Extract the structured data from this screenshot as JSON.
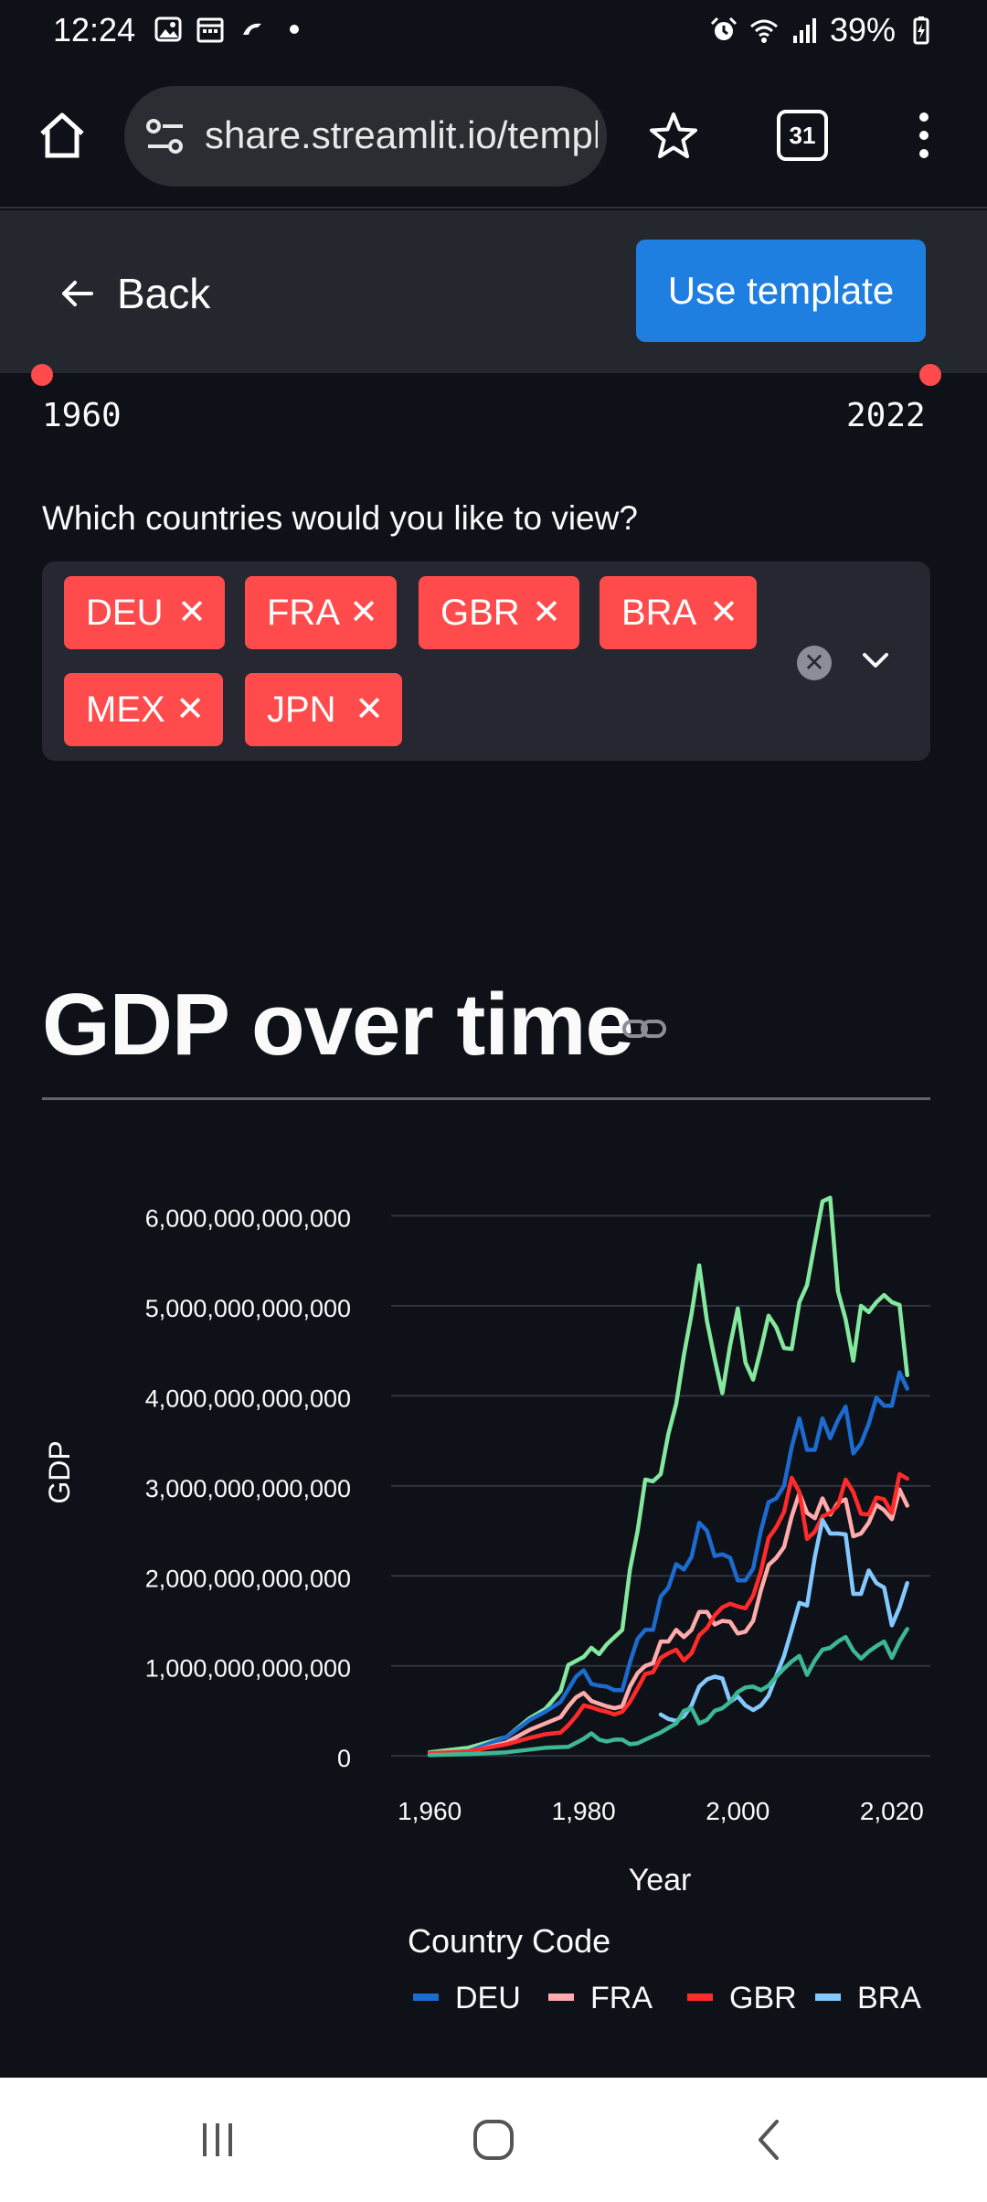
{
  "status": {
    "time": "12:24",
    "battery": "39%"
  },
  "browser": {
    "url": "share.streamlit.io/template-preview",
    "tab_count": "31"
  },
  "header": {
    "back_label": "Back",
    "use_template_label": "Use template"
  },
  "slider": {
    "min_label": "1960",
    "max_label": "2022"
  },
  "countries": {
    "question": "Which countries would you like to view?",
    "selected": [
      "DEU",
      "FRA",
      "GBR",
      "BRA",
      "MEX",
      "JPN"
    ]
  },
  "section": {
    "title": "GDP over time"
  },
  "chart_data": {
    "type": "line",
    "xlabel": "Year",
    "ylabel": "GDP",
    "xlim": [
      1955,
      2025
    ],
    "ylim": [
      -100000000000,
      6300000000000
    ],
    "x_ticks": [
      1960,
      1980,
      2000,
      2020
    ],
    "x_tick_labels": [
      "1,960",
      "1,980",
      "2,000",
      "2,020"
    ],
    "y_ticks": [
      0,
      1000000000000,
      2000000000000,
      3000000000000,
      4000000000000,
      5000000000000,
      6000000000000
    ],
    "y_tick_labels": [
      "0",
      "1,000,000,000,000",
      "2,000,000,000,000",
      "3,000,000,000,000",
      "4,000,000,000,000",
      "5,000,000,000,000",
      "6,000,000,000,000"
    ],
    "legend_title": "Country Code",
    "legend_placement": "bottom",
    "grid": true,
    "series": [
      {
        "name": "JPN",
        "legend": false,
        "color": "#84e89f",
        "points": [
          [
            1960,
            0.04
          ],
          [
            1965,
            0.09
          ],
          [
            1970,
            0.21
          ],
          [
            1973,
            0.42
          ],
          [
            1975,
            0.52
          ],
          [
            1977,
            0.72
          ],
          [
            1978,
            1.01
          ],
          [
            1980,
            1.1
          ],
          [
            1981,
            1.2
          ],
          [
            1982,
            1.13
          ],
          [
            1983,
            1.24
          ],
          [
            1985,
            1.4
          ],
          [
            1986,
            2.07
          ],
          [
            1987,
            2.5
          ],
          [
            1988,
            3.07
          ],
          [
            1989,
            3.05
          ],
          [
            1990,
            3.13
          ],
          [
            1991,
            3.58
          ],
          [
            1992,
            3.91
          ],
          [
            1993,
            4.45
          ],
          [
            1994,
            4.91
          ],
          [
            1995,
            5.45
          ],
          [
            1996,
            4.83
          ],
          [
            1997,
            4.41
          ],
          [
            1998,
            4.03
          ],
          [
            1999,
            4.56
          ],
          [
            2000,
            4.97
          ],
          [
            2001,
            4.37
          ],
          [
            2002,
            4.18
          ],
          [
            2003,
            4.52
          ],
          [
            2004,
            4.89
          ],
          [
            2005,
            4.76
          ],
          [
            2006,
            4.53
          ],
          [
            2007,
            4.52
          ],
          [
            2008,
            5.04
          ],
          [
            2009,
            5.23
          ],
          [
            2010,
            5.7
          ],
          [
            2011,
            6.16
          ],
          [
            2012,
            6.2
          ],
          [
            2013,
            5.16
          ],
          [
            2014,
            4.85
          ],
          [
            2015,
            4.39
          ],
          [
            2016,
            5.0
          ],
          [
            2017,
            4.93
          ],
          [
            2018,
            5.04
          ],
          [
            2019,
            5.12
          ],
          [
            2020,
            5.04
          ],
          [
            2021,
            5.01
          ],
          [
            2022,
            4.23
          ]
        ]
      },
      {
        "name": "DEU",
        "legend": true,
        "color": "#1c6bd0",
        "points": [
          [
            1960,
            0.02
          ],
          [
            1965,
            0.05
          ],
          [
            1970,
            0.21
          ],
          [
            1973,
            0.4
          ],
          [
            1975,
            0.49
          ],
          [
            1977,
            0.6
          ],
          [
            1978,
            0.74
          ],
          [
            1979,
            0.88
          ],
          [
            1980,
            0.95
          ],
          [
            1981,
            0.8
          ],
          [
            1982,
            0.78
          ],
          [
            1983,
            0.77
          ],
          [
            1984,
            0.73
          ],
          [
            1985,
            0.73
          ],
          [
            1986,
            1.04
          ],
          [
            1987,
            1.3
          ],
          [
            1988,
            1.4
          ],
          [
            1989,
            1.4
          ],
          [
            1990,
            1.77
          ],
          [
            1991,
            1.87
          ],
          [
            1992,
            2.13
          ],
          [
            1993,
            2.07
          ],
          [
            1994,
            2.21
          ],
          [
            1995,
            2.59
          ],
          [
            1996,
            2.5
          ],
          [
            1997,
            2.22
          ],
          [
            1998,
            2.24
          ],
          [
            1999,
            2.2
          ],
          [
            2000,
            1.95
          ],
          [
            2001,
            1.95
          ],
          [
            2002,
            2.08
          ],
          [
            2003,
            2.5
          ],
          [
            2004,
            2.82
          ],
          [
            2005,
            2.86
          ],
          [
            2006,
            3.0
          ],
          [
            2007,
            3.43
          ],
          [
            2008,
            3.75
          ],
          [
            2009,
            3.4
          ],
          [
            2010,
            3.4
          ],
          [
            2011,
            3.75
          ],
          [
            2012,
            3.53
          ],
          [
            2013,
            3.73
          ],
          [
            2014,
            3.88
          ],
          [
            2015,
            3.36
          ],
          [
            2016,
            3.47
          ],
          [
            2017,
            3.69
          ],
          [
            2018,
            3.98
          ],
          [
            2019,
            3.89
          ],
          [
            2020,
            3.89
          ],
          [
            2021,
            4.26
          ],
          [
            2022,
            4.08
          ]
        ]
      },
      {
        "name": "FRA",
        "legend": true,
        "color": "#ffabab",
        "points": [
          [
            1960,
            0.01
          ],
          [
            1965,
            0.04
          ],
          [
            1970,
            0.15
          ],
          [
            1973,
            0.29
          ],
          [
            1975,
            0.36
          ],
          [
            1977,
            0.43
          ],
          [
            1978,
            0.55
          ],
          [
            1979,
            0.65
          ],
          [
            1980,
            0.7
          ],
          [
            1981,
            0.61
          ],
          [
            1982,
            0.58
          ],
          [
            1983,
            0.55
          ],
          [
            1984,
            0.53
          ],
          [
            1985,
            0.55
          ],
          [
            1986,
            0.77
          ],
          [
            1987,
            0.92
          ],
          [
            1988,
            1.0
          ],
          [
            1989,
            1.03
          ],
          [
            1990,
            1.27
          ],
          [
            1991,
            1.27
          ],
          [
            1992,
            1.4
          ],
          [
            1993,
            1.32
          ],
          [
            1994,
            1.4
          ],
          [
            1995,
            1.6
          ],
          [
            1996,
            1.6
          ],
          [
            1997,
            1.46
          ],
          [
            1998,
            1.5
          ],
          [
            1999,
            1.49
          ],
          [
            2000,
            1.36
          ],
          [
            2001,
            1.38
          ],
          [
            2002,
            1.5
          ],
          [
            2003,
            1.84
          ],
          [
            2004,
            2.12
          ],
          [
            2005,
            2.2
          ],
          [
            2006,
            2.32
          ],
          [
            2007,
            2.66
          ],
          [
            2008,
            2.92
          ],
          [
            2009,
            2.7
          ],
          [
            2010,
            2.64
          ],
          [
            2011,
            2.86
          ],
          [
            2012,
            2.68
          ],
          [
            2013,
            2.81
          ],
          [
            2014,
            2.85
          ],
          [
            2015,
            2.44
          ],
          [
            2016,
            2.47
          ],
          [
            2017,
            2.59
          ],
          [
            2018,
            2.79
          ],
          [
            2019,
            2.73
          ],
          [
            2020,
            2.63
          ],
          [
            2021,
            2.96
          ],
          [
            2022,
            2.78
          ]
        ]
      },
      {
        "name": "GBR",
        "legend": true,
        "color": "#ff2b2b",
        "points": [
          [
            1960,
            0.03
          ],
          [
            1965,
            0.05
          ],
          [
            1970,
            0.13
          ],
          [
            1973,
            0.2
          ],
          [
            1975,
            0.24
          ],
          [
            1977,
            0.26
          ],
          [
            1978,
            0.34
          ],
          [
            1979,
            0.44
          ],
          [
            1980,
            0.56
          ],
          [
            1981,
            0.54
          ],
          [
            1982,
            0.51
          ],
          [
            1983,
            0.49
          ],
          [
            1984,
            0.46
          ],
          [
            1985,
            0.49
          ],
          [
            1986,
            0.6
          ],
          [
            1987,
            0.75
          ],
          [
            1988,
            0.91
          ],
          [
            1989,
            0.93
          ],
          [
            1990,
            1.09
          ],
          [
            1991,
            1.14
          ],
          [
            1992,
            1.18
          ],
          [
            1993,
            1.06
          ],
          [
            1994,
            1.14
          ],
          [
            1995,
            1.34
          ],
          [
            1996,
            1.42
          ],
          [
            1997,
            1.56
          ],
          [
            1998,
            1.65
          ],
          [
            1999,
            1.69
          ],
          [
            2000,
            1.66
          ],
          [
            2001,
            1.64
          ],
          [
            2002,
            1.78
          ],
          [
            2003,
            2.05
          ],
          [
            2004,
            2.42
          ],
          [
            2005,
            2.54
          ],
          [
            2006,
            2.71
          ],
          [
            2007,
            3.09
          ],
          [
            2008,
            2.93
          ],
          [
            2009,
            2.41
          ],
          [
            2010,
            2.49
          ],
          [
            2011,
            2.66
          ],
          [
            2012,
            2.7
          ],
          [
            2013,
            2.78
          ],
          [
            2014,
            3.07
          ],
          [
            2015,
            2.93
          ],
          [
            2016,
            2.69
          ],
          [
            2017,
            2.68
          ],
          [
            2018,
            2.87
          ],
          [
            2019,
            2.85
          ],
          [
            2020,
            2.7
          ],
          [
            2021,
            3.13
          ],
          [
            2022,
            3.08
          ]
        ]
      },
      {
        "name": "BRA",
        "legend": true,
        "color": "#83c9ff",
        "points": [
          [
            1990,
            0.46
          ],
          [
            1991,
            0.41
          ],
          [
            1992,
            0.39
          ],
          [
            1993,
            0.44
          ],
          [
            1994,
            0.56
          ],
          [
            1995,
            0.77
          ],
          [
            1996,
            0.85
          ],
          [
            1997,
            0.88
          ],
          [
            1998,
            0.86
          ],
          [
            1999,
            0.6
          ],
          [
            2000,
            0.66
          ],
          [
            2001,
            0.56
          ],
          [
            2002,
            0.51
          ],
          [
            2003,
            0.56
          ],
          [
            2004,
            0.67
          ],
          [
            2005,
            0.89
          ],
          [
            2006,
            1.11
          ],
          [
            2007,
            1.4
          ],
          [
            2008,
            1.7
          ],
          [
            2009,
            1.67
          ],
          [
            2010,
            2.21
          ],
          [
            2011,
            2.62
          ],
          [
            2012,
            2.47
          ],
          [
            2013,
            2.47
          ],
          [
            2014,
            2.46
          ],
          [
            2015,
            1.8
          ],
          [
            2016,
            1.8
          ],
          [
            2017,
            2.06
          ],
          [
            2018,
            1.92
          ],
          [
            2019,
            1.87
          ],
          [
            2020,
            1.45
          ],
          [
            2021,
            1.65
          ],
          [
            2022,
            1.92
          ]
        ]
      },
      {
        "name": "MEX",
        "legend": false,
        "color": "#3cb894",
        "points": [
          [
            1960,
            0.01
          ],
          [
            1965,
            0.02
          ],
          [
            1970,
            0.04
          ],
          [
            1975,
            0.09
          ],
          [
            1978,
            0.1
          ],
          [
            1980,
            0.19
          ],
          [
            1981,
            0.25
          ],
          [
            1982,
            0.18
          ],
          [
            1983,
            0.16
          ],
          [
            1984,
            0.18
          ],
          [
            1985,
            0.18
          ],
          [
            1986,
            0.13
          ],
          [
            1987,
            0.14
          ],
          [
            1988,
            0.18
          ],
          [
            1989,
            0.22
          ],
          [
            1990,
            0.26
          ],
          [
            1991,
            0.31
          ],
          [
            1992,
            0.36
          ],
          [
            1993,
            0.5
          ],
          [
            1994,
            0.53
          ],
          [
            1995,
            0.36
          ],
          [
            1996,
            0.4
          ],
          [
            1997,
            0.5
          ],
          [
            1998,
            0.53
          ],
          [
            1999,
            0.6
          ],
          [
            2000,
            0.71
          ],
          [
            2001,
            0.76
          ],
          [
            2002,
            0.77
          ],
          [
            2003,
            0.73
          ],
          [
            2004,
            0.78
          ],
          [
            2005,
            0.88
          ],
          [
            2006,
            0.97
          ],
          [
            2007,
            1.05
          ],
          [
            2008,
            1.11
          ],
          [
            2009,
            0.9
          ],
          [
            2010,
            1.06
          ],
          [
            2011,
            1.18
          ],
          [
            2012,
            1.2
          ],
          [
            2013,
            1.27
          ],
          [
            2014,
            1.32
          ],
          [
            2015,
            1.17
          ],
          [
            2016,
            1.08
          ],
          [
            2017,
            1.16
          ],
          [
            2018,
            1.22
          ],
          [
            2019,
            1.27
          ],
          [
            2020,
            1.09
          ],
          [
            2021,
            1.27
          ],
          [
            2022,
            1.41
          ]
        ]
      }
    ]
  }
}
